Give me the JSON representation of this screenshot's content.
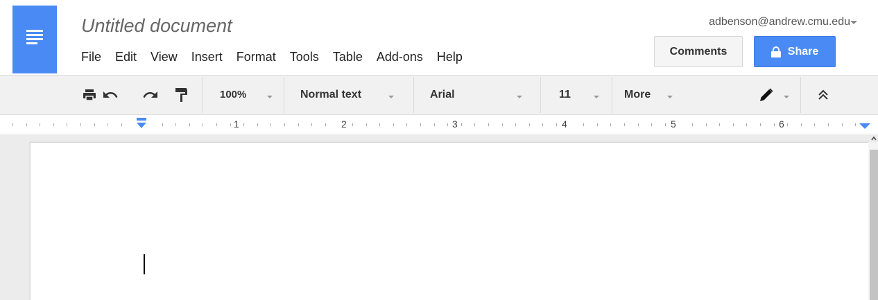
{
  "document": {
    "title": "Untitled document"
  },
  "account": {
    "email": "adbenson@andrew.cmu.edu"
  },
  "menu": [
    "File",
    "Edit",
    "View",
    "Insert",
    "Format",
    "Tools",
    "Table",
    "Add-ons",
    "Help"
  ],
  "buttons": {
    "comments": "Comments",
    "share": "Share"
  },
  "toolbar": {
    "zoom": "100%",
    "style": "Normal text",
    "font": "Arial",
    "font_size": "11",
    "more": "More",
    "icons": [
      "print-icon",
      "undo-icon",
      "redo-icon",
      "paint-format-icon",
      "pencil-icon",
      "collapse-icon"
    ]
  },
  "ruler": {
    "numbers": [
      "1",
      "2",
      "3",
      "4",
      "5",
      "6"
    ]
  },
  "colors": {
    "brand": "#4a8af4",
    "toolbar_bg": "#f1f1f1",
    "canvas_bg": "#ececec"
  }
}
